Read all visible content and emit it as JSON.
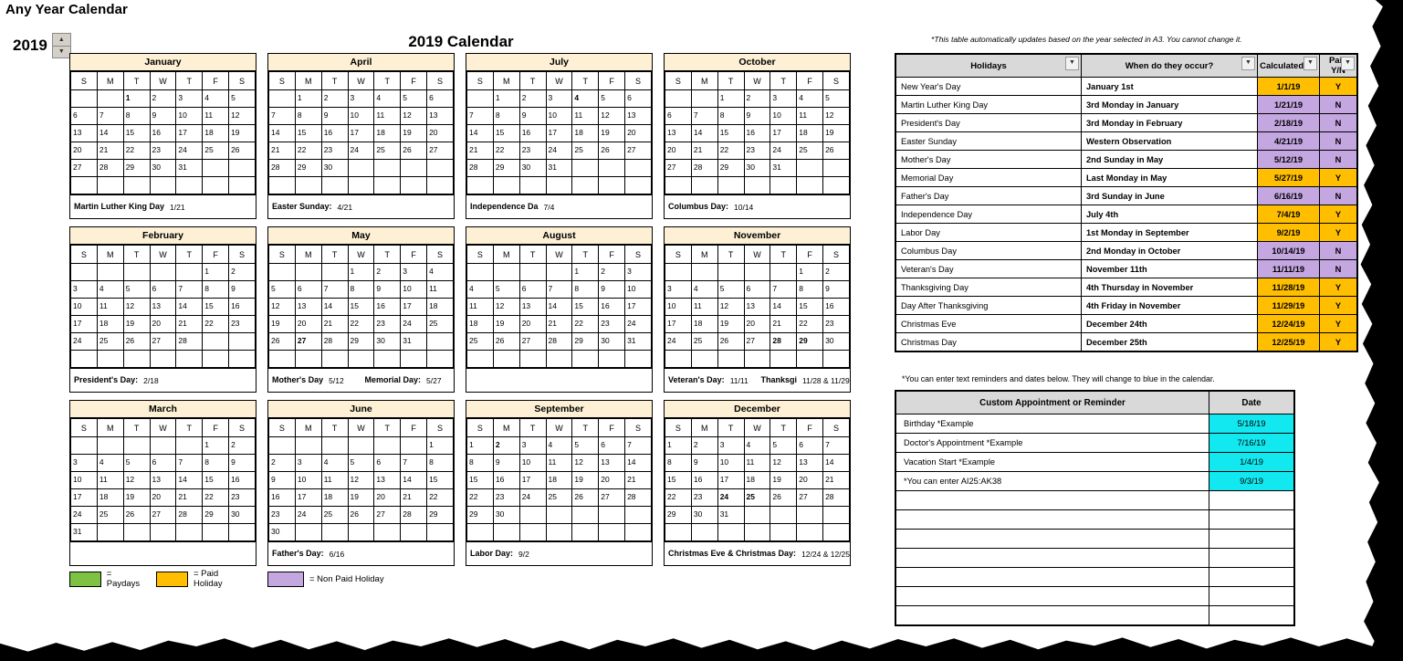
{
  "app": {
    "title": "Any Year Calendar",
    "year": "2019",
    "main_title": "2019 Calendar",
    "spinner_up": "▲",
    "spinner_down": "▼"
  },
  "legend": [
    {
      "swatch": "green",
      "label": "= Paydays"
    },
    {
      "swatch": "orange",
      "label": "= Paid Holiday"
    },
    {
      "swatch": "purple",
      "label": "= Non Paid Holiday"
    }
  ],
  "weekday_headers": [
    "S",
    "M",
    "T",
    "W",
    "T",
    "F",
    "S"
  ],
  "months": [
    {
      "name": "January",
      "lead": 2,
      "days": 31,
      "marks": {
        "1": "paid",
        "4": "pay",
        "18": "pay",
        "21": "nonpaid"
      },
      "notes": [
        {
          "label": "Martin Luther King Day",
          "date": "1/21"
        }
      ]
    },
    {
      "name": "April",
      "lead": 1,
      "days": 30,
      "marks": {
        "12": "pay",
        "21": "nonpaid",
        "26": "pay"
      },
      "notes": [
        {
          "label": "Easter Sunday:",
          "date": "4/21"
        }
      ]
    },
    {
      "name": "July",
      "lead": 1,
      "days": 31,
      "marks": {
        "4": "paid",
        "5": "pay",
        "16": "custom",
        "19": "pay"
      },
      "notes": [
        {
          "label": "Independence Da",
          "date": "7/4"
        }
      ]
    },
    {
      "name": "October",
      "lead": 2,
      "days": 31,
      "marks": {
        "11": "pay",
        "14": "nonpaid",
        "25": "pay"
      },
      "notes": [
        {
          "label": "Columbus Day:",
          "date": "10/14"
        }
      ]
    },
    {
      "name": "February",
      "lead": 5,
      "days": 28,
      "marks": {
        "1": "pay",
        "15": "pay",
        "18": "nonpaid"
      },
      "notes": [
        {
          "label": "President's Day:",
          "date": "2/18"
        }
      ]
    },
    {
      "name": "May",
      "lead": 3,
      "days": 31,
      "marks": {
        "10": "pay",
        "12": "nonpaid",
        "18": "custom",
        "24": "pay",
        "27": "paid"
      },
      "notes": [
        {
          "label": "Mother's Day",
          "date": "5/12"
        },
        {
          "label": "Memorial Day:",
          "date": "5/27"
        }
      ]
    },
    {
      "name": "August",
      "lead": 4,
      "days": 31,
      "marks": {
        "2": "pay",
        "16": "pay",
        "30": "pay"
      },
      "notes": []
    },
    {
      "name": "November",
      "lead": 5,
      "days": 30,
      "marks": {
        "8": "pay",
        "11": "nonpaid",
        "22": "pay",
        "28": "paid",
        "29": "paid"
      },
      "notes": [
        {
          "label": "Veteran's Day:",
          "date": "11/11"
        },
        {
          "label": "Thanksgi",
          "date": "11/28 & 11/29"
        }
      ]
    },
    {
      "name": "March",
      "lead": 5,
      "days": 31,
      "marks": {
        "1": "pay",
        "15": "pay",
        "29": "pay"
      },
      "notes": []
    },
    {
      "name": "June",
      "lead": 6,
      "days": 30,
      "marks": {
        "7": "pay",
        "16": "nonpaid",
        "21": "pay"
      },
      "notes": [
        {
          "label": "Father's Day:",
          "date": "6/16"
        }
      ]
    },
    {
      "name": "September",
      "lead": 0,
      "days": 30,
      "marks": {
        "2": "paid",
        "3": "custom",
        "13": "pay",
        "27": "pay"
      },
      "notes": [
        {
          "label": "Labor Day:",
          "date": "9/2"
        }
      ]
    },
    {
      "name": "December",
      "lead": 0,
      "days": 31,
      "marks": {
        "6": "pay",
        "20": "pay",
        "22": "custom",
        "24": "paid",
        "25": "paid"
      },
      "notes": [
        {
          "label": "Christmas Eve & Christmas Day:",
          "date": "12/24 & 12/25"
        }
      ]
    }
  ],
  "holidays_panel": {
    "hint": "*This table automatically updates based on the year selected in A3.  You cannot change it.",
    "columns": [
      "Holidays",
      "When do they occur?",
      "Calculated Da",
      "Paid Y/N"
    ],
    "filter_icon": "▼",
    "rows": [
      {
        "holiday": "New Year's Day",
        "when": "January 1st",
        "date": "1/1/19",
        "paid": "Y",
        "color": "orange"
      },
      {
        "holiday": "Martin Luther King Day",
        "when": "3rd Monday in January",
        "date": "1/21/19",
        "paid": "N",
        "color": "purple"
      },
      {
        "holiday": "President's Day",
        "when": "3rd Monday in February",
        "date": "2/18/19",
        "paid": "N",
        "color": "purple"
      },
      {
        "holiday": "Easter Sunday",
        "when": "Western Observation",
        "date": "4/21/19",
        "paid": "N",
        "color": "purple"
      },
      {
        "holiday": "Mother's Day",
        "when": "2nd Sunday in May",
        "date": "5/12/19",
        "paid": "N",
        "color": "purple"
      },
      {
        "holiday": "Memorial Day",
        "when": "Last Monday in May",
        "date": "5/27/19",
        "paid": "Y",
        "color": "orange"
      },
      {
        "holiday": "Father's Day",
        "when": "3rd Sunday in June",
        "date": "6/16/19",
        "paid": "N",
        "color": "purple"
      },
      {
        "holiday": "Independence Day",
        "when": "July 4th",
        "date": "7/4/19",
        "paid": "Y",
        "color": "orange"
      },
      {
        "holiday": "Labor Day",
        "when": "1st Monday in September",
        "date": "9/2/19",
        "paid": "Y",
        "color": "orange"
      },
      {
        "holiday": "Columbus Day",
        "when": "2nd Monday in October",
        "date": "10/14/19",
        "paid": "N",
        "color": "purple"
      },
      {
        "holiday": "Veteran's Day",
        "when": "November 11th",
        "date": "11/11/19",
        "paid": "N",
        "color": "purple"
      },
      {
        "holiday": "Thanksgiving Day",
        "when": "4th Thursday in November",
        "date": "11/28/19",
        "paid": "Y",
        "color": "orange"
      },
      {
        "holiday": "Day After Thanksgiving",
        "when": "4th Friday in November",
        "date": "11/29/19",
        "paid": "Y",
        "color": "orange"
      },
      {
        "holiday": "Christmas Eve",
        "when": "December 24th",
        "date": "12/24/19",
        "paid": "Y",
        "color": "orange"
      },
      {
        "holiday": "Christmas Day",
        "when": "December 25th",
        "date": "12/25/19",
        "paid": "Y",
        "color": "orange"
      }
    ]
  },
  "appointments_panel": {
    "hint": "*You can enter text reminders and dates below.  They will change to blue in the calendar.",
    "columns": [
      "Custom Appointment or Reminder",
      "Date"
    ],
    "rows": [
      {
        "text": "Birthday *Example",
        "date": "5/18/19"
      },
      {
        "text": "Doctor's Appointment *Example",
        "date": "7/16/19"
      },
      {
        "text": "Vacation Start *Example",
        "date": "1/4/19"
      },
      {
        "text": "*You can enter AI25:AK38",
        "date": "9/3/19"
      },
      {
        "text": "",
        "date": ""
      },
      {
        "text": "",
        "date": ""
      },
      {
        "text": "",
        "date": ""
      },
      {
        "text": "",
        "date": ""
      },
      {
        "text": "",
        "date": ""
      },
      {
        "text": "",
        "date": ""
      },
      {
        "text": "",
        "date": ""
      }
    ]
  },
  "colors": {
    "payday": "#7dc242",
    "paid_holiday": "#ffbf00",
    "non_paid_holiday": "#c4a6e0",
    "custom": "#12e8f0",
    "month_header": "#fdf0d5",
    "table_header": "#d9d9d9"
  }
}
